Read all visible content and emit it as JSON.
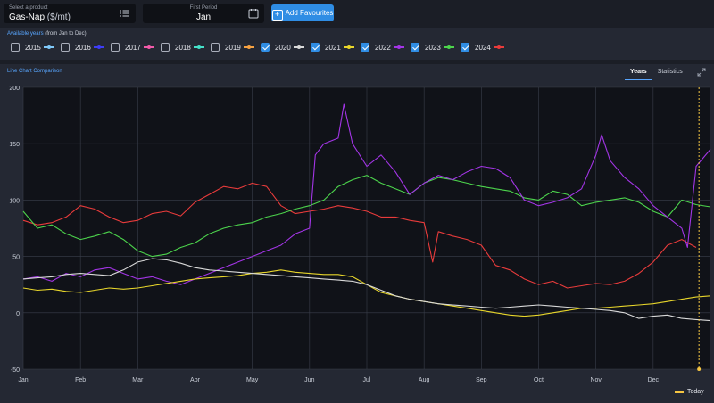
{
  "product": {
    "label": "Select a product",
    "value": "Gas-Nap",
    "unit": "($/mt)"
  },
  "period": {
    "label": "First Period",
    "value": "Jan"
  },
  "add_favourites": "Add Favourites",
  "available_years": {
    "label": "Available years",
    "sub": "(from Jan to Dec)"
  },
  "years": [
    {
      "year": "2015",
      "checked": false,
      "color": "#7fc8f8"
    },
    {
      "year": "2016",
      "checked": false,
      "color": "#3d3df5"
    },
    {
      "year": "2017",
      "checked": false,
      "color": "#f05aa8"
    },
    {
      "year": "2018",
      "checked": false,
      "color": "#45e0c8"
    },
    {
      "year": "2019",
      "checked": false,
      "color": "#f5a142"
    },
    {
      "year": "2020",
      "checked": true,
      "color": "#d9d9d9"
    },
    {
      "year": "2021",
      "checked": true,
      "color": "#e8d62b"
    },
    {
      "year": "2022",
      "checked": true,
      "color": "#a335e6"
    },
    {
      "year": "2023",
      "checked": true,
      "color": "#4cd44c"
    },
    {
      "year": "2024",
      "checked": true,
      "color": "#e83b3b"
    }
  ],
  "chart_title": "Line Chart Comparison",
  "tabs": [
    {
      "label": "Years",
      "active": true
    },
    {
      "label": "Statistics",
      "active": false
    }
  ],
  "today_label": "Today",
  "chart_data": {
    "type": "line",
    "title": "",
    "xlabel": "",
    "ylabel": "",
    "x_tick_labels": [
      "Jan",
      "Feb",
      "Mar",
      "Apr",
      "May",
      "Jun",
      "Jul",
      "Aug",
      "Sep",
      "Oct",
      "Nov",
      "Dec"
    ],
    "y_ticks": [
      200,
      150,
      100,
      50,
      0,
      -50
    ],
    "ylim": [
      -50,
      200
    ],
    "xlim": [
      0,
      12
    ],
    "grid": true,
    "today_x": 11.8,
    "today_color": "#f5c542",
    "series": [
      {
        "name": "2024",
        "color": "#e83b3b",
        "x": [
          0,
          0.25,
          0.5,
          0.75,
          1.0,
          1.25,
          1.5,
          1.75,
          2.0,
          2.25,
          2.5,
          2.75,
          3.0,
          3.25,
          3.5,
          3.75,
          4.0,
          4.25,
          4.5,
          4.75,
          5.0,
          5.25,
          5.5,
          5.75,
          6.0,
          6.25,
          6.5,
          6.75,
          7.0,
          7.15,
          7.25,
          7.5,
          7.75,
          8.0,
          8.25,
          8.5,
          8.75,
          9.0,
          9.25,
          9.5,
          9.75,
          10.0,
          10.25,
          10.5,
          10.75,
          11.0,
          11.25,
          11.5,
          11.75
        ],
        "y": [
          82,
          78,
          80,
          85,
          95,
          92,
          85,
          80,
          82,
          88,
          90,
          86,
          98,
          105,
          112,
          110,
          115,
          112,
          95,
          88,
          90,
          92,
          95,
          93,
          90,
          85,
          85,
          82,
          80,
          45,
          72,
          68,
          65,
          60,
          42,
          38,
          30,
          25,
          28,
          22,
          24,
          26,
          25,
          28,
          35,
          45,
          60,
          65,
          58
        ]
      },
      {
        "name": "2023",
        "color": "#4cd44c",
        "x": [
          0,
          0.25,
          0.5,
          0.75,
          1.0,
          1.25,
          1.5,
          1.75,
          2.0,
          2.25,
          2.5,
          2.75,
          3.0,
          3.25,
          3.5,
          3.75,
          4.0,
          4.25,
          4.5,
          4.75,
          5.0,
          5.25,
          5.5,
          5.75,
          6.0,
          6.25,
          6.5,
          6.75,
          7.0,
          7.25,
          7.5,
          7.75,
          8.0,
          8.25,
          8.5,
          8.75,
          9.0,
          9.25,
          9.5,
          9.75,
          10.0,
          10.25,
          10.5,
          10.75,
          11.0,
          11.25,
          11.5,
          11.75,
          12.0
        ],
        "y": [
          90,
          75,
          78,
          70,
          65,
          68,
          72,
          65,
          55,
          50,
          52,
          58,
          62,
          70,
          75,
          78,
          80,
          85,
          88,
          92,
          95,
          100,
          112,
          118,
          122,
          115,
          110,
          105,
          115,
          120,
          118,
          115,
          112,
          110,
          108,
          102,
          100,
          108,
          105,
          95,
          98,
          100,
          102,
          98,
          90,
          85,
          100,
          96,
          94
        ]
      },
      {
        "name": "2022",
        "color": "#a335e6",
        "x": [
          0,
          0.25,
          0.5,
          0.75,
          1.0,
          1.25,
          1.5,
          1.75,
          2.0,
          2.25,
          2.5,
          2.75,
          3.0,
          3.25,
          3.5,
          3.75,
          4.0,
          4.25,
          4.5,
          4.75,
          5.0,
          5.1,
          5.25,
          5.5,
          5.6,
          5.75,
          6.0,
          6.25,
          6.5,
          6.75,
          7.0,
          7.25,
          7.5,
          7.75,
          8.0,
          8.25,
          8.5,
          8.75,
          9.0,
          9.25,
          9.5,
          9.75,
          10.0,
          10.1,
          10.25,
          10.5,
          10.75,
          11.0,
          11.25,
          11.5,
          11.6,
          11.75,
          12.0
        ],
        "y": [
          30,
          32,
          28,
          35,
          32,
          38,
          40,
          35,
          30,
          32,
          28,
          25,
          30,
          35,
          40,
          45,
          50,
          55,
          60,
          70,
          75,
          140,
          150,
          155,
          185,
          150,
          130,
          140,
          125,
          105,
          115,
          122,
          118,
          125,
          130,
          128,
          120,
          100,
          95,
          98,
          102,
          110,
          140,
          158,
          135,
          120,
          110,
          95,
          85,
          75,
          58,
          130,
          145
        ]
      },
      {
        "name": "2021",
        "color": "#e8d62b",
        "x": [
          0,
          0.25,
          0.5,
          0.75,
          1.0,
          1.25,
          1.5,
          1.75,
          2.0,
          2.25,
          2.5,
          2.75,
          3.0,
          3.25,
          3.5,
          3.75,
          4.0,
          4.25,
          4.5,
          4.75,
          5.0,
          5.25,
          5.5,
          5.75,
          6.0,
          6.25,
          6.5,
          6.75,
          7.0,
          7.25,
          7.5,
          7.75,
          8.0,
          8.25,
          8.5,
          8.75,
          9.0,
          9.25,
          9.5,
          9.75,
          10.0,
          10.25,
          10.5,
          10.75,
          11.0,
          11.25,
          11.5,
          11.75,
          12.0
        ],
        "y": [
          22,
          20,
          21,
          19,
          18,
          20,
          22,
          21,
          22,
          24,
          26,
          28,
          30,
          31,
          32,
          33,
          35,
          36,
          38,
          36,
          35,
          34,
          34,
          32,
          25,
          18,
          15,
          12,
          10,
          8,
          6,
          4,
          2,
          0,
          -2,
          -3,
          -2,
          0,
          2,
          4,
          4,
          5,
          6,
          7,
          8,
          10,
          12,
          14,
          15
        ]
      },
      {
        "name": "2020",
        "color": "#d9d9d9",
        "x": [
          0,
          0.25,
          0.5,
          0.75,
          1.0,
          1.25,
          1.5,
          1.75,
          2.0,
          2.25,
          2.5,
          2.75,
          3.0,
          3.25,
          3.5,
          3.75,
          4.0,
          4.25,
          4.5,
          4.75,
          5.0,
          5.25,
          5.5,
          5.75,
          6.0,
          6.25,
          6.5,
          6.75,
          7.0,
          7.25,
          7.5,
          7.75,
          8.0,
          8.25,
          8.5,
          8.75,
          9.0,
          9.25,
          9.5,
          9.75,
          10.0,
          10.25,
          10.5,
          10.75,
          11.0,
          11.25,
          11.5,
          11.75,
          12.0
        ],
        "y": [
          30,
          31,
          32,
          34,
          35,
          34,
          33,
          38,
          45,
          48,
          47,
          44,
          40,
          38,
          37,
          36,
          35,
          34,
          33,
          32,
          31,
          30,
          29,
          28,
          25,
          20,
          15,
          12,
          10,
          8,
          7,
          6,
          5,
          4,
          5,
          6,
          7,
          6,
          5,
          4,
          3,
          2,
          0,
          -5,
          -3,
          -2,
          -5,
          -6,
          -7
        ]
      }
    ]
  }
}
